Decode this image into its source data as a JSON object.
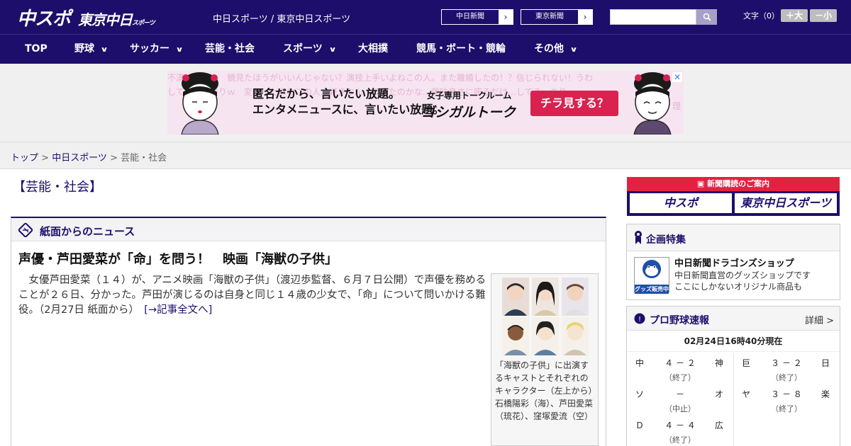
{
  "header": {
    "logo_main": "中スポ",
    "logo_tokyo": "東京中日",
    "logo_tokyo_small": "スポーツ",
    "site_title": "中日スポーツ / 東京中日スポーツ",
    "btn_chunichi": "中日新聞",
    "btn_tokyo": "東京新聞",
    "search_placeholder": "",
    "font_label": "文字（0）",
    "font_bigger": "＋大",
    "font_smaller": "－小"
  },
  "nav": [
    {
      "label": "TOP",
      "has_menu": false
    },
    {
      "label": "野球",
      "has_menu": true
    },
    {
      "label": "サッカー",
      "has_menu": true
    },
    {
      "label": "芸能・社会",
      "has_menu": false
    },
    {
      "label": "スポーツ",
      "has_menu": true
    },
    {
      "label": "大相撲",
      "has_menu": false
    },
    {
      "label": "競馬・ボート・競輪",
      "has_menu": false
    },
    {
      "label": "その他",
      "has_menu": true
    }
  ],
  "ad": {
    "bg_line1": "不満ばかりｗ　鏡見たほうがいいんじゃない？演技上手いよねこの人。また離婚したの！？信じられない！うわ",
    "bg_line2": "してる…ばかりｗ　変わったよねこの人…好きなん…できたのかな…趣味良さに座るだけ…してる…あり　",
    "bg_line3": "理",
    "main_line1": "匿名だから、言いたい放題。",
    "main_line2": "エンタメニュースに、言いたい放題。",
    "sub": "女子専用トークルーム",
    "brand": "ゴシガルトーク",
    "cta": "チラ見する？",
    "close": "✕"
  },
  "breadcrumb": {
    "home": "トップ",
    "sep1": " > ",
    "section": "中日スポーツ",
    "sep2": " > ",
    "current": "芸能・社会"
  },
  "page_heading": "【芸能・社会】",
  "news": {
    "box_title": "紙面からのニュース",
    "article_title": "声優・芦田愛菜が「命」を問う！　映画「海獣の子供」",
    "article_body": "　女優芦田愛菜（１４）が、アニメ映画「海獣の子供」（渡辺歩監督、６月７日公開）で声優を務めることが２６日、分かった。芦田が演じるのは自身と同じ１４歳の少女で、「命」について問いかける難役。（2月27日 紙面から）",
    "more_link": "[→記事全文へ]",
    "photo_caption": "「海獣の子供」に出演するキャストとそれぞれのキャラクター（左上から）石橋陽彩（海）、芦田愛菜（琉花）、窪塚愛流（空）"
  },
  "sidebar": {
    "subscribe_head": "新聞購読のご案内",
    "subscribe_btn1": "中スポ",
    "subscribe_btn2": "東京中日スポーツ",
    "feature_title": "企画特集",
    "feature_item_title": "中日新聞ドラゴンズショップ",
    "feature_item_desc1": "中日新聞直営のグッズショップです",
    "feature_item_desc2": "ここにしかないオリジナル商品も",
    "feature_thumb_label": "グッズ販売中",
    "baseball_title": "プロ野球速報",
    "baseball_detail": "詳細 >",
    "baseball_date": "02月24日16時40分現在",
    "games_left": [
      {
        "home": "中",
        "score": "４ － ２",
        "away": "神",
        "status": "（終了）"
      },
      {
        "home": "ソ",
        "score": "－",
        "away": "オ",
        "status": "（中止）"
      },
      {
        "home": "Ｄ",
        "score": "４ － ４",
        "away": "広",
        "status": "（終了）"
      }
    ],
    "games_right": [
      {
        "home": "巨",
        "score": "３ － ２",
        "away": "日",
        "status": "（終了）"
      },
      {
        "home": "ヤ",
        "score": "３ － ８",
        "away": "楽",
        "status": "（終了）"
      }
    ]
  },
  "colors": {
    "brand_navy": "#1d0e6b",
    "ad_pink": "#f7e4f1",
    "accent_red": "#e2233f"
  }
}
